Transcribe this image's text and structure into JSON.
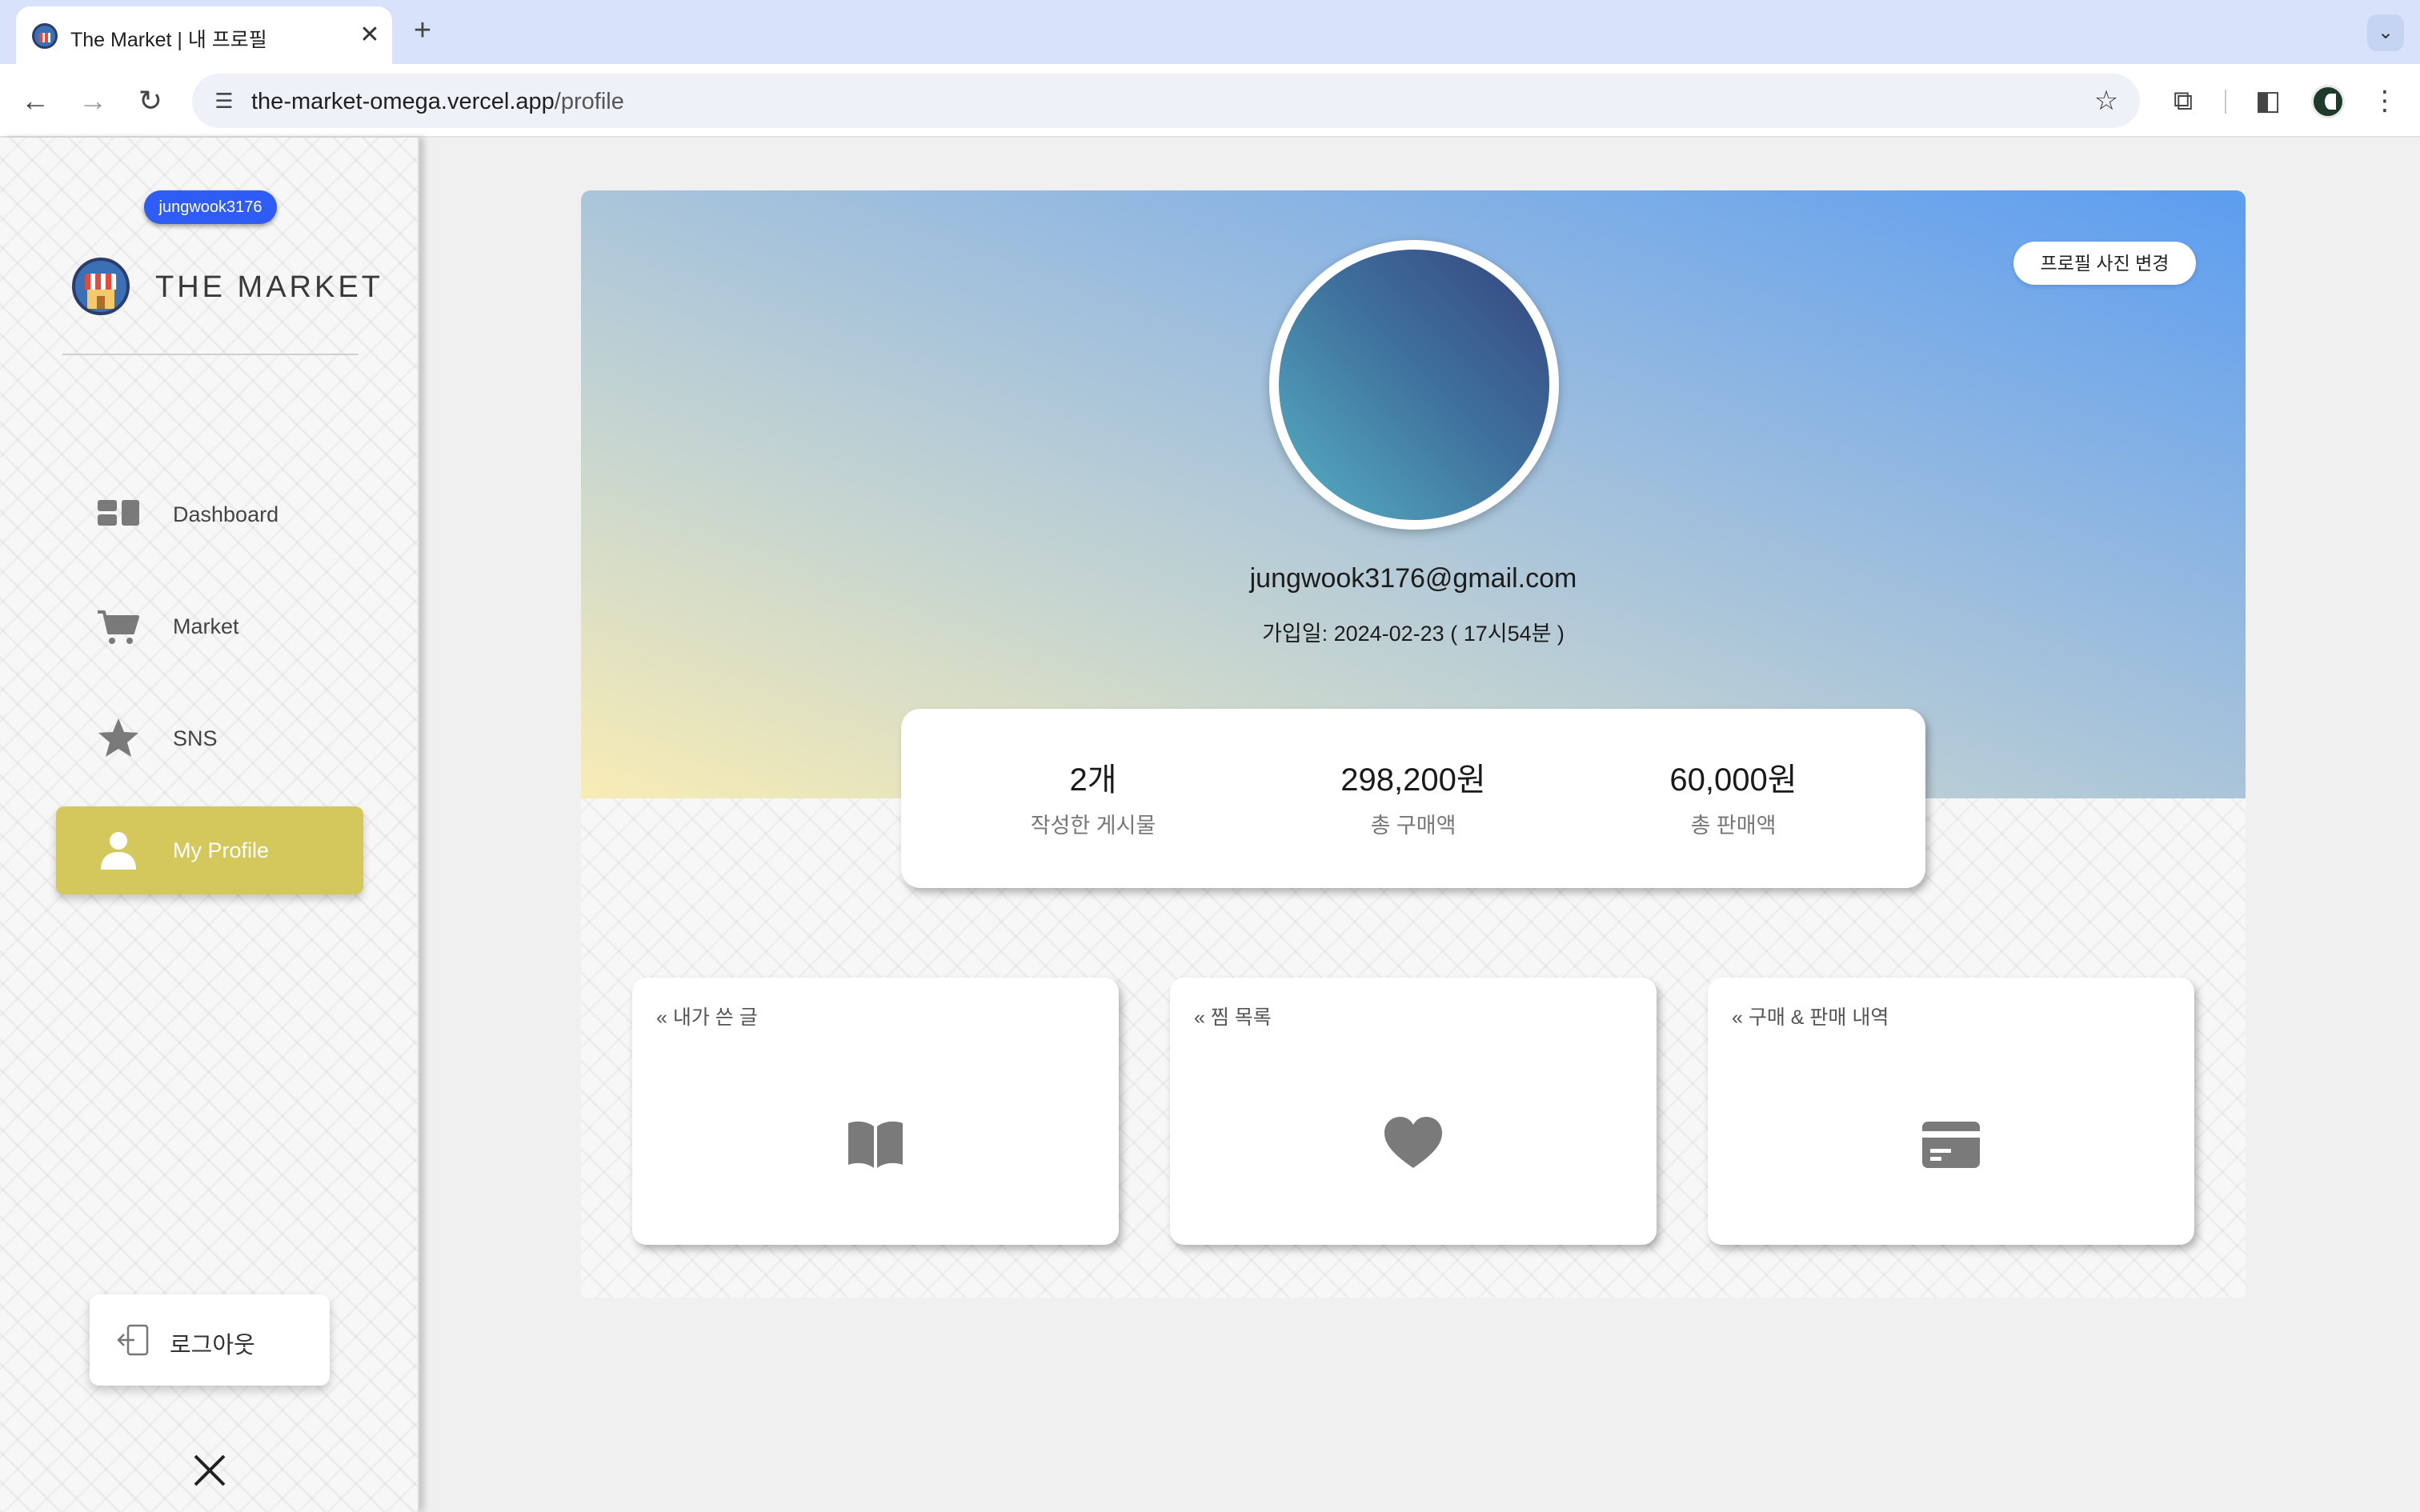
{
  "browser": {
    "tab_title": "The Market | 내 프로필",
    "new_tab": "+",
    "tab_close": "✕",
    "url_host": "the-market-omega.vercel.app",
    "url_path": "/profile"
  },
  "sidebar": {
    "user_badge": "jungwook3176",
    "logo_text": "THE MARKET",
    "items": [
      {
        "label": "Dashboard",
        "icon": "dashboard-icon",
        "active": false
      },
      {
        "label": "Market",
        "icon": "cart-icon",
        "active": false
      },
      {
        "label": "SNS",
        "icon": "star-icon",
        "active": false
      },
      {
        "label": "My Profile",
        "icon": "person-icon",
        "active": true
      }
    ],
    "logout_label": "로그아웃"
  },
  "profile": {
    "change_photo_label": "프로필 사진 변경",
    "email": "jungwook3176@gmail.com",
    "join_date": "가입일: 2024-02-23 ( 17시54분 )",
    "stats": [
      {
        "value": "2개",
        "label": "작성한 게시물"
      },
      {
        "value": "298,200원",
        "label": "총 구매액"
      },
      {
        "value": "60,000원",
        "label": "총 판매액"
      }
    ],
    "menu_cards": [
      {
        "title": "« 내가 쓴 글",
        "icon": "book-icon"
      },
      {
        "title": "« 찜 목록",
        "icon": "heart-icon"
      },
      {
        "title": "« 구매 & 판매 내역",
        "icon": "credit-card-icon"
      }
    ]
  },
  "colors": {
    "active_nav": "#d4c85c",
    "user_badge": "#2f5cf5",
    "icon_gray": "#7a7a7a"
  }
}
